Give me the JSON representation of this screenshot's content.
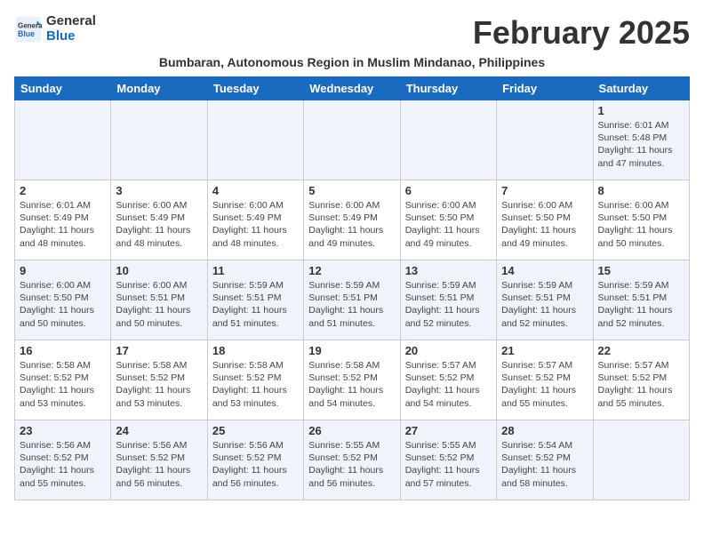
{
  "header": {
    "logo_line1": "General",
    "logo_line2": "Blue",
    "month_title": "February 2025",
    "subtitle": "Bumbaran, Autonomous Region in Muslim Mindanao, Philippines"
  },
  "days_of_week": [
    "Sunday",
    "Monday",
    "Tuesday",
    "Wednesday",
    "Thursday",
    "Friday",
    "Saturday"
  ],
  "weeks": [
    [
      {
        "day": "",
        "content": ""
      },
      {
        "day": "",
        "content": ""
      },
      {
        "day": "",
        "content": ""
      },
      {
        "day": "",
        "content": ""
      },
      {
        "day": "",
        "content": ""
      },
      {
        "day": "",
        "content": ""
      },
      {
        "day": "1",
        "content": "Sunrise: 6:01 AM\nSunset: 5:48 PM\nDaylight: 11 hours\nand 47 minutes."
      }
    ],
    [
      {
        "day": "2",
        "content": "Sunrise: 6:01 AM\nSunset: 5:49 PM\nDaylight: 11 hours\nand 48 minutes."
      },
      {
        "day": "3",
        "content": "Sunrise: 6:00 AM\nSunset: 5:49 PM\nDaylight: 11 hours\nand 48 minutes."
      },
      {
        "day": "4",
        "content": "Sunrise: 6:00 AM\nSunset: 5:49 PM\nDaylight: 11 hours\nand 48 minutes."
      },
      {
        "day": "5",
        "content": "Sunrise: 6:00 AM\nSunset: 5:49 PM\nDaylight: 11 hours\nand 49 minutes."
      },
      {
        "day": "6",
        "content": "Sunrise: 6:00 AM\nSunset: 5:50 PM\nDaylight: 11 hours\nand 49 minutes."
      },
      {
        "day": "7",
        "content": "Sunrise: 6:00 AM\nSunset: 5:50 PM\nDaylight: 11 hours\nand 49 minutes."
      },
      {
        "day": "8",
        "content": "Sunrise: 6:00 AM\nSunset: 5:50 PM\nDaylight: 11 hours\nand 50 minutes."
      }
    ],
    [
      {
        "day": "9",
        "content": "Sunrise: 6:00 AM\nSunset: 5:50 PM\nDaylight: 11 hours\nand 50 minutes."
      },
      {
        "day": "10",
        "content": "Sunrise: 6:00 AM\nSunset: 5:51 PM\nDaylight: 11 hours\nand 50 minutes."
      },
      {
        "day": "11",
        "content": "Sunrise: 5:59 AM\nSunset: 5:51 PM\nDaylight: 11 hours\nand 51 minutes."
      },
      {
        "day": "12",
        "content": "Sunrise: 5:59 AM\nSunset: 5:51 PM\nDaylight: 11 hours\nand 51 minutes."
      },
      {
        "day": "13",
        "content": "Sunrise: 5:59 AM\nSunset: 5:51 PM\nDaylight: 11 hours\nand 52 minutes."
      },
      {
        "day": "14",
        "content": "Sunrise: 5:59 AM\nSunset: 5:51 PM\nDaylight: 11 hours\nand 52 minutes."
      },
      {
        "day": "15",
        "content": "Sunrise: 5:59 AM\nSunset: 5:51 PM\nDaylight: 11 hours\nand 52 minutes."
      }
    ],
    [
      {
        "day": "16",
        "content": "Sunrise: 5:58 AM\nSunset: 5:52 PM\nDaylight: 11 hours\nand 53 minutes."
      },
      {
        "day": "17",
        "content": "Sunrise: 5:58 AM\nSunset: 5:52 PM\nDaylight: 11 hours\nand 53 minutes."
      },
      {
        "day": "18",
        "content": "Sunrise: 5:58 AM\nSunset: 5:52 PM\nDaylight: 11 hours\nand 53 minutes."
      },
      {
        "day": "19",
        "content": "Sunrise: 5:58 AM\nSunset: 5:52 PM\nDaylight: 11 hours\nand 54 minutes."
      },
      {
        "day": "20",
        "content": "Sunrise: 5:57 AM\nSunset: 5:52 PM\nDaylight: 11 hours\nand 54 minutes."
      },
      {
        "day": "21",
        "content": "Sunrise: 5:57 AM\nSunset: 5:52 PM\nDaylight: 11 hours\nand 55 minutes."
      },
      {
        "day": "22",
        "content": "Sunrise: 5:57 AM\nSunset: 5:52 PM\nDaylight: 11 hours\nand 55 minutes."
      }
    ],
    [
      {
        "day": "23",
        "content": "Sunrise: 5:56 AM\nSunset: 5:52 PM\nDaylight: 11 hours\nand 55 minutes."
      },
      {
        "day": "24",
        "content": "Sunrise: 5:56 AM\nSunset: 5:52 PM\nDaylight: 11 hours\nand 56 minutes."
      },
      {
        "day": "25",
        "content": "Sunrise: 5:56 AM\nSunset: 5:52 PM\nDaylight: 11 hours\nand 56 minutes."
      },
      {
        "day": "26",
        "content": "Sunrise: 5:55 AM\nSunset: 5:52 PM\nDaylight: 11 hours\nand 56 minutes."
      },
      {
        "day": "27",
        "content": "Sunrise: 5:55 AM\nSunset: 5:52 PM\nDaylight: 11 hours\nand 57 minutes."
      },
      {
        "day": "28",
        "content": "Sunrise: 5:54 AM\nSunset: 5:52 PM\nDaylight: 11 hours\nand 58 minutes."
      },
      {
        "day": "",
        "content": ""
      }
    ]
  ]
}
